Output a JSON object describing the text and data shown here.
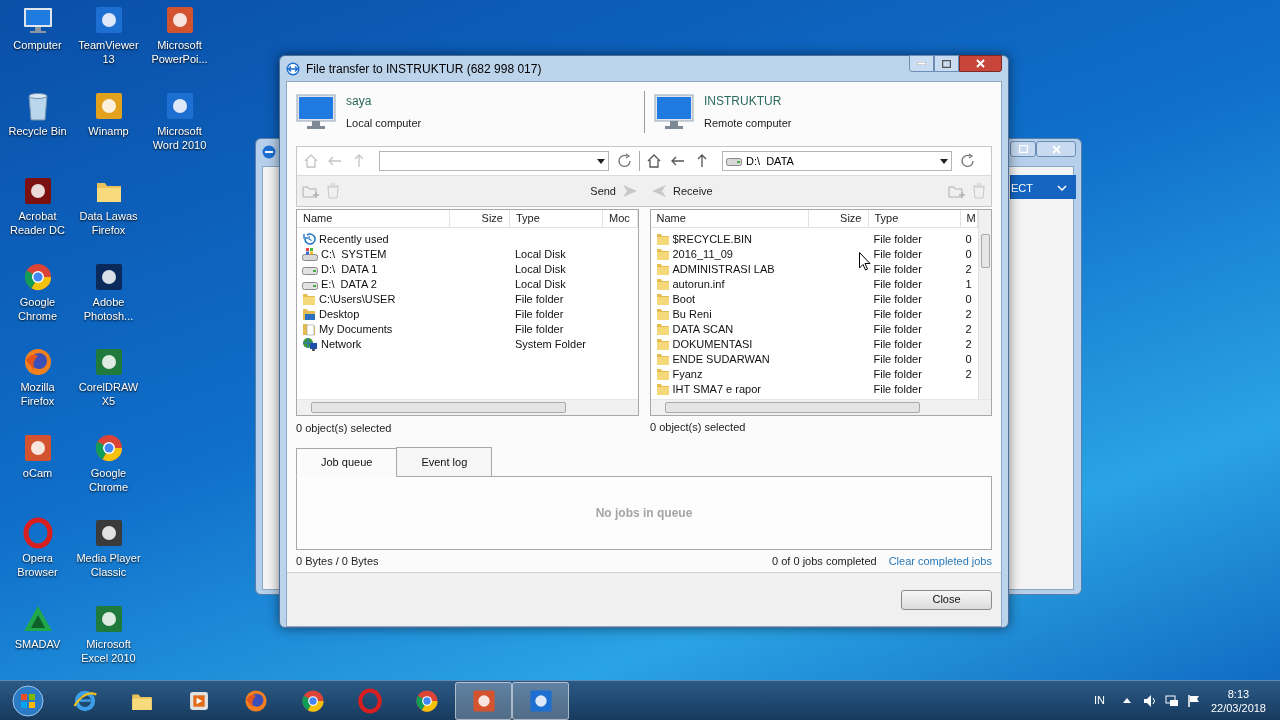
{
  "desktop_icons": [
    {
      "label": "Computer",
      "kind": "monitor"
    },
    {
      "label": "Recycle Bin",
      "kind": "bin"
    },
    {
      "label": "Acrobat Reader DC",
      "kind": "redtile"
    },
    {
      "label": "Google Chrome",
      "kind": "ring"
    },
    {
      "label": "Mozilla Firefox",
      "kind": "fox"
    },
    {
      "label": "oCam",
      "kind": "orangetile"
    },
    {
      "label": "Opera Browser",
      "kind": "redring"
    },
    {
      "label": "SMADAV",
      "kind": "triangle"
    },
    {
      "label": "TeamViewer 13",
      "kind": "bluetile"
    },
    {
      "label": "Winamp",
      "kind": "yellowtile"
    },
    {
      "label": "Data Lawas Firefox",
      "kind": "folder"
    },
    {
      "label": "Adobe Photosh...",
      "kind": "darkbluetile"
    },
    {
      "label": "CorelDRAW X5",
      "kind": "greentile"
    },
    {
      "label": "Google Chrome",
      "kind": "ring"
    },
    {
      "label": "Media Player Classic",
      "kind": "darktile"
    },
    {
      "label": "Microsoft Excel 2010",
      "kind": "greentile"
    },
    {
      "label": "Microsoft PowerPoi...",
      "kind": "orangetile"
    },
    {
      "label": "Microsoft Word 2010",
      "kind": "bluetile"
    }
  ],
  "background_window": {
    "button_text": "ECT"
  },
  "window": {
    "title": "File transfer to INSTRUKTUR (682 998 017)"
  },
  "local": {
    "name": "saya",
    "role": "Local computer",
    "nav_disabled": true,
    "action": "Send",
    "columns": [
      "Name",
      "Size",
      "Type",
      "Moc"
    ],
    "rows": [
      {
        "name": "Recently used",
        "kind": "recent"
      },
      {
        "name": "C:\\  SYSTEM",
        "type": "Local Disk",
        "kind": "sysdrive"
      },
      {
        "name": "D:\\  DATA 1",
        "type": "Local Disk",
        "kind": "drive"
      },
      {
        "name": "E:\\  DATA 2",
        "type": "Local Disk",
        "kind": "drive"
      },
      {
        "name": "C:\\Users\\USER",
        "type": "File folder",
        "kind": "folder"
      },
      {
        "name": "Desktop",
        "type": "File folder",
        "kind": "desktopfolder"
      },
      {
        "name": "My Documents",
        "type": "File folder",
        "kind": "docsfolder"
      },
      {
        "name": "Network",
        "type": "System Folder",
        "kind": "network"
      }
    ],
    "status": "0 object(s) selected"
  },
  "remote": {
    "name": "INSTRUKTUR",
    "role": "Remote computer",
    "nav_disabled": false,
    "path": "D:\\  DATA",
    "action": "Receive",
    "columns": [
      "Name",
      "Size",
      "Type",
      "M"
    ],
    "rows": [
      {
        "name": "$RECYCLE.BIN",
        "type": "File folder",
        "column_4": "0",
        "kind": "folder"
      },
      {
        "name": "2016_11_09",
        "type": "File folder",
        "column_4": "0",
        "kind": "folder"
      },
      {
        "name": "ADMINISTRASI LAB",
        "type": "File folder",
        "column_4": "2",
        "kind": "folder"
      },
      {
        "name": "autorun.inf",
        "type": "File folder",
        "column_4": "1",
        "kind": "folder"
      },
      {
        "name": "Boot",
        "type": "File folder",
        "column_4": "0",
        "kind": "folder"
      },
      {
        "name": "Bu Reni",
        "type": "File folder",
        "column_4": "2",
        "kind": "folder"
      },
      {
        "name": "DATA SCAN",
        "type": "File folder",
        "column_4": "2",
        "kind": "folder"
      },
      {
        "name": "DOKUMENTASI",
        "type": "File folder",
        "column_4": "2",
        "kind": "folder"
      },
      {
        "name": "ENDE SUDARWAN",
        "type": "File folder",
        "column_4": "0",
        "kind": "folder"
      },
      {
        "name": "Fyanz",
        "type": "File folder",
        "column_4": "2",
        "kind": "folder"
      },
      {
        "name": "IHT SMA7 e rapor",
        "type": "File folder",
        "kind": "folder"
      }
    ],
    "status": "0 object(s) selected"
  },
  "tabs": [
    {
      "label": "Job queue",
      "selected": true
    },
    {
      "label": "Event log",
      "selected": false
    }
  ],
  "queue": {
    "empty_text": "No jobs in queue",
    "bytes": "0 Bytes / 0 Bytes",
    "progress": "0 of 0 jobs completed",
    "clear_link": "Clear completed jobs"
  },
  "footer": {
    "close": "Close"
  },
  "taskbar": {
    "pinned": [
      {
        "kind": "ie",
        "active": false
      },
      {
        "kind": "explorer",
        "active": false
      },
      {
        "kind": "media",
        "active": false
      },
      {
        "kind": "fox",
        "active": false
      },
      {
        "kind": "ring",
        "active": false
      },
      {
        "kind": "redring",
        "active": false
      },
      {
        "kind": "ring",
        "active": false
      },
      {
        "kind": "orangetile",
        "active": true
      },
      {
        "kind": "bluetile",
        "active": true
      }
    ],
    "language": "IN",
    "time": "8:13",
    "date": "22/03/2018"
  }
}
